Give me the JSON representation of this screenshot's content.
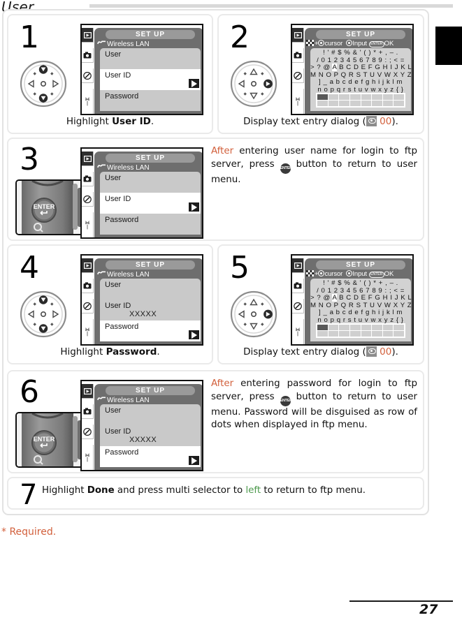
{
  "header": {
    "title": "User",
    "required_marker": "*",
    "edge_tab": "black-tab-marker"
  },
  "footer": {
    "required_note": "* Required.",
    "page_number": "27"
  },
  "lcd": {
    "title": "SET  UP",
    "subtitle": "Wireless LAN",
    "tabs": [
      "playback-icon",
      "camera-icon",
      "pencil-icon",
      "wrench-icon"
    ],
    "rows": {
      "user": "User",
      "user_id": "User ID",
      "password": "Password"
    },
    "masked_value": "XXXXX"
  },
  "text_entry": {
    "title": "SET  UP",
    "hint_cursor": "cursor",
    "hint_input": "Input",
    "hint_ok": "OK",
    "hint_enter_label": "ENTER",
    "plus": "+",
    "rows": [
      "!  '  # $ % &  '  (  )  *  + ,  –  .",
      "/ 0 1 2 3 4 5 6 7 8 9 :  ;  < =",
      "> ? @ A B C D E F G H I J K L",
      "M N O P Q R S T U V W X Y Z [",
      "]  _ a b c d e f g h i  j  k l m",
      "n o p q r s t u v w x y z { }"
    ],
    "highlight_char": "A",
    "grid_columns": 8,
    "grid_rows": 2
  },
  "steps": [
    {
      "number": "1",
      "kind": "screen-with-dial",
      "caption_prefix": "Highlight ",
      "caption_bold": "User ID",
      "caption_suffix": ".",
      "dial_direction": "up-down"
    },
    {
      "number": "2",
      "kind": "text-entry-with-dial",
      "caption_prefix": "Display text entry dialog (",
      "caption_ref": "00",
      "caption_suffix": ").",
      "dial_direction": "right"
    },
    {
      "number": "3",
      "kind": "screen-with-enter-button",
      "text_lead": "After",
      "text_body_1": " entering user name for login to ftp server, press ",
      "text_body_2": " button to return to user menu."
    },
    {
      "number": "4",
      "kind": "screen-with-dial",
      "caption_prefix": "Highlight ",
      "caption_bold": "Password",
      "caption_suffix": ".",
      "dial_direction": "up-down"
    },
    {
      "number": "5",
      "kind": "text-entry-with-dial",
      "caption_prefix": "Display text entry dialog (",
      "caption_ref": "00",
      "caption_suffix": ").",
      "dial_direction": "right"
    },
    {
      "number": "6",
      "kind": "screen-with-enter-button",
      "text_lead": "After",
      "text_body_1": " entering password for login to ftp server, press ",
      "text_body_2": " button to return to user menu.  Password will be disguised as row of dots when displayed in ftp menu."
    },
    {
      "number": "7",
      "kind": "text-only",
      "text_a": "Highlight ",
      "text_bold": "Done",
      "text_b": " and press multi selector to ",
      "text_green": "left",
      "text_c": " to return to ftp menu."
    }
  ],
  "colors": {
    "accent_orange": "#d2603c",
    "accent_green": "#4e9a4e",
    "lcd_body": "#6e6e6e",
    "menu_bg": "#c9c9c9"
  }
}
